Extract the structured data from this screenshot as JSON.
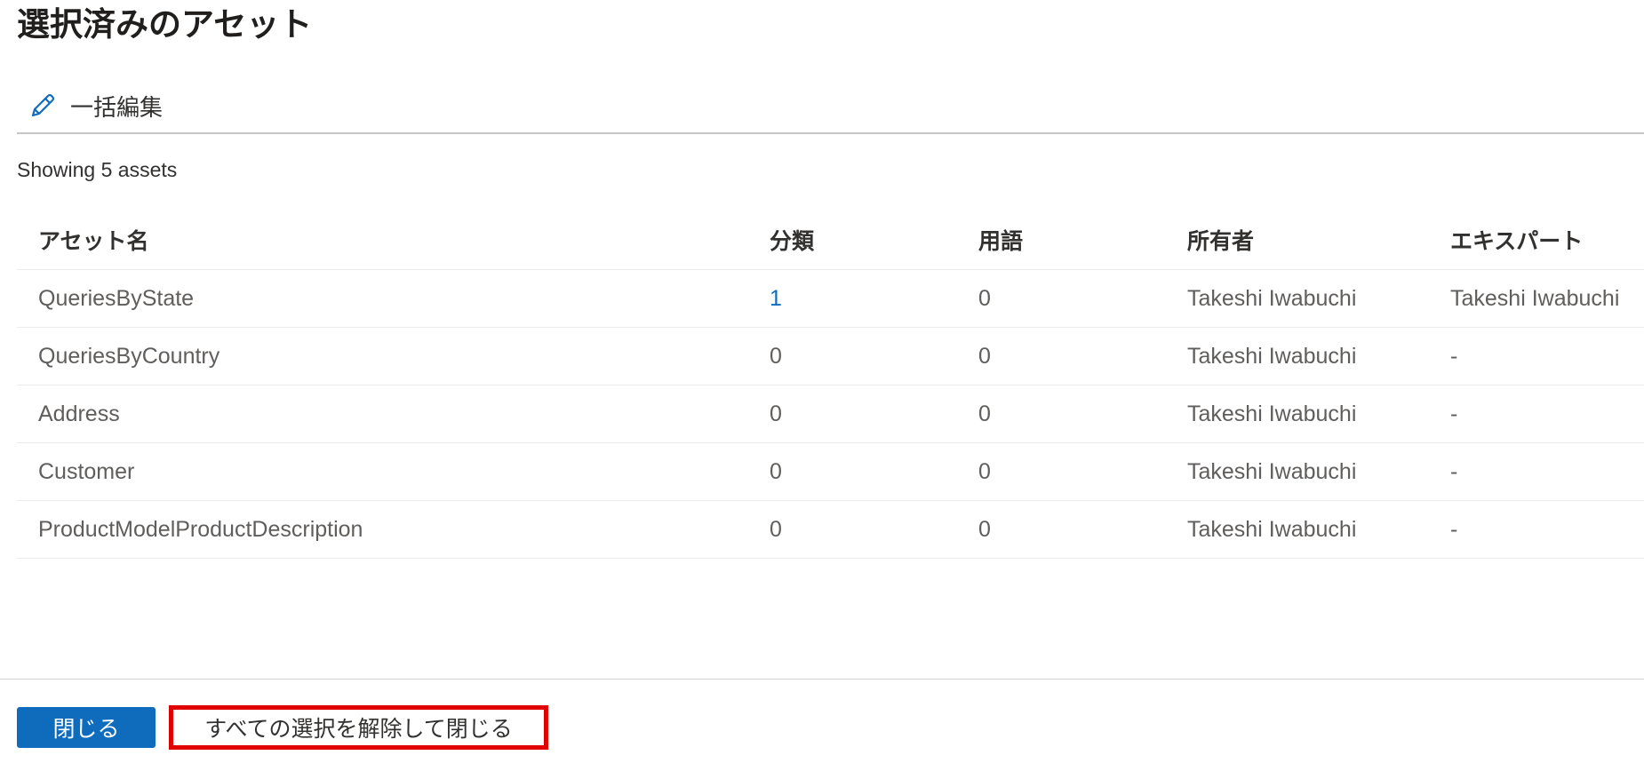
{
  "header": {
    "title": "選択済みのアセット"
  },
  "toolbar": {
    "bulk_edit_label": "一括編集",
    "bulk_edit_icon": "pencil-icon"
  },
  "summary": {
    "showing_text": "Showing 5 assets"
  },
  "table": {
    "columns": [
      "アセット名",
      "分類",
      "用語",
      "所有者",
      "エキスパート"
    ],
    "rows": [
      [
        "QueriesByState",
        "1",
        "0",
        "Takeshi Iwabuchi",
        "Takeshi Iwabuchi"
      ],
      [
        "QueriesByCountry",
        "0",
        "0",
        "Takeshi Iwabuchi",
        "-"
      ],
      [
        "Address",
        "0",
        "0",
        "Takeshi Iwabuchi",
        "-"
      ],
      [
        "Customer",
        "0",
        "0",
        "Takeshi Iwabuchi",
        "-"
      ],
      [
        "ProductModelProductDescription",
        "0",
        "0",
        "Takeshi Iwabuchi",
        "-"
      ]
    ]
  },
  "footer": {
    "close_label": "閉じる",
    "deselect_close_label": "すべての選択を解除して閉じる"
  },
  "colors": {
    "primary": "#0f6cbd",
    "highlight_border": "#e00000"
  }
}
